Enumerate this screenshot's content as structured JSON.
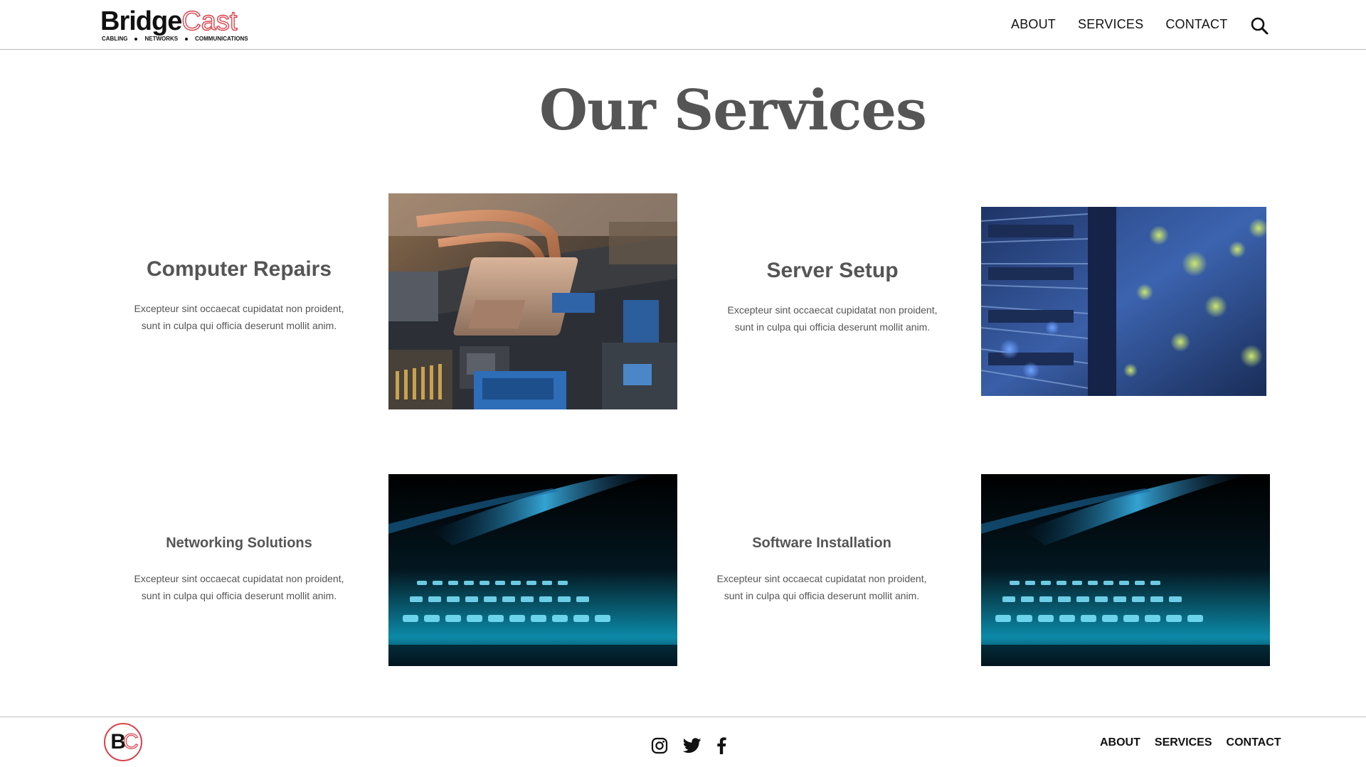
{
  "header": {
    "logo": {
      "bridge": "Bridge",
      "cast": "Cast",
      "tag1": "CABLING",
      "tag2": "NETWORKS",
      "tag3": "COMMUNICATIONS"
    },
    "nav": [
      {
        "label": "ABOUT"
      },
      {
        "label": "SERVICES"
      },
      {
        "label": "CONTACT"
      }
    ],
    "search_icon": "search-icon"
  },
  "main": {
    "title": "Our Services",
    "services": [
      {
        "title": "Computer Repairs",
        "text_line1": "Excepteur sint occaecat cupidatat non proident,",
        "text_line2": "sunt in culpa qui officia deserunt mollit anim.",
        "image": "motherboard-photo"
      },
      {
        "title": "Server Setup",
        "text_line1": "Excepteur sint occaecat cupidatat non proident,",
        "text_line2": "sunt in culpa qui officia deserunt mollit anim.",
        "image": "server-rack-photo"
      },
      {
        "title": "Networking Solutions",
        "text_line1": "Excepteur sint occaecat cupidatat non proident,",
        "text_line2": "sunt in culpa qui officia deserunt mollit anim.",
        "image": "backlit-keyboard-photo"
      },
      {
        "title": "Software Installation",
        "text_line1": "Excepteur sint occaecat cupidatat non proident,",
        "text_line2": "sunt in culpa qui officia deserunt mollit anim.",
        "image": "backlit-keyboard-photo"
      }
    ]
  },
  "footer": {
    "logo": {
      "b": "B",
      "c": "C"
    },
    "social": [
      "instagram-icon",
      "twitter-icon",
      "facebook-icon"
    ],
    "nav": [
      {
        "label": "ABOUT"
      },
      {
        "label": "SERVICES"
      },
      {
        "label": "CONTACT"
      }
    ]
  },
  "colors": {
    "brand_red": "#d9424b",
    "heading_gray": "#555555",
    "text": "#111111"
  }
}
